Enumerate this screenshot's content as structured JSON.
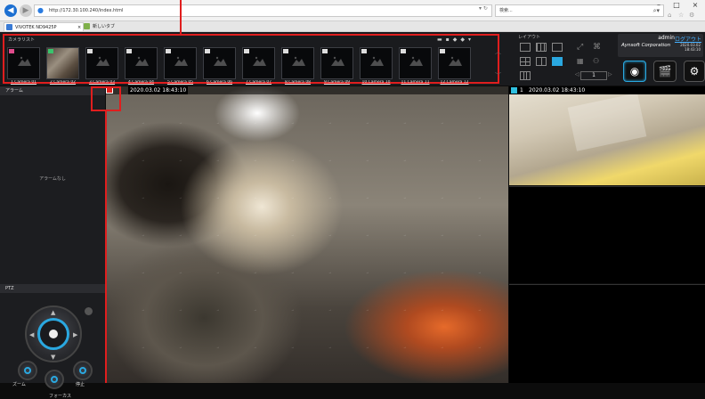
{
  "browser": {
    "url": "http://172.30.100.240/index.html",
    "search_placeholder": "検索...",
    "tabs": [
      {
        "label": "VIVOTEK ND9425P",
        "close": "×"
      },
      {
        "label": "新しいタブ"
      }
    ],
    "controls": {
      "minimize": "–",
      "maximize": "□",
      "close": "×"
    }
  },
  "camera_list": {
    "title": "カメラリスト",
    "cameras": [
      {
        "label": "1.Camera 01"
      },
      {
        "label": "2.Camera 02"
      },
      {
        "label": "3.Camera 03"
      },
      {
        "label": "4.Camera 04"
      },
      {
        "label": "5.Camera 05"
      },
      {
        "label": "6.Camera 06"
      },
      {
        "label": "7.Camera 07"
      },
      {
        "label": "8.Camera 08"
      },
      {
        "label": "9.Camera 09"
      },
      {
        "label": "10.Camera 10"
      },
      {
        "label": "11.Camera 11"
      },
      {
        "label": "12.Camera 12"
      }
    ]
  },
  "layout": {
    "title": "レイアウト",
    "page": "1"
  },
  "user": {
    "name": "admin",
    "link": "ログアウト",
    "logo": "Aynsoft Corporation",
    "date": "2020.03.02",
    "time": "18:43:10"
  },
  "alarm": {
    "title": "アラーム",
    "empty": "アラームなし"
  },
  "ptz": {
    "title": "PTZ",
    "zoom": "ズーム",
    "stop": "停止",
    "focus": "フォーカス"
  },
  "video_main": {
    "timestamp": "2020.03.02 18:43:10"
  },
  "video_r1": {
    "cam": "1",
    "timestamp": "2020.03.02 18:43:10"
  },
  "colors": {
    "accent": "#2aa8e0",
    "annotation": "#e01e1e",
    "rec": "#e0231e"
  }
}
